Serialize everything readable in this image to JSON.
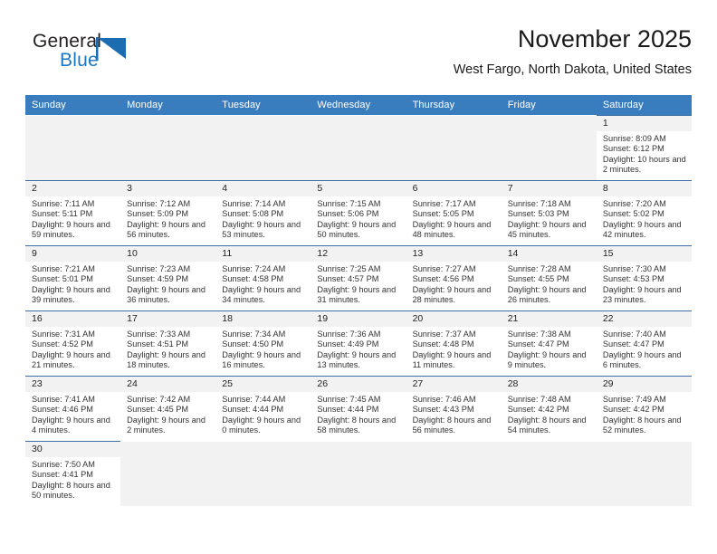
{
  "logo": {
    "text_top": "General",
    "text_bottom": "Blue",
    "triangle_icon": "blue-triangle-icon",
    "color": "#1b77c4"
  },
  "header": {
    "title": "November 2025",
    "subtitle": "West Fargo, North Dakota, United States"
  },
  "theme": {
    "header_row_bg": "#3a7dbf",
    "cell_header_bg": "#f2f2f2",
    "cell_border": "#3a6ea5"
  },
  "weekdays": [
    "Sunday",
    "Monday",
    "Tuesday",
    "Wednesday",
    "Thursday",
    "Friday",
    "Saturday"
  ],
  "labels": {
    "sunrise": "Sunrise:",
    "sunset": "Sunset:",
    "daylight": "Daylight:"
  },
  "weeks": [
    [
      {
        "blank": true
      },
      {
        "blank": true
      },
      {
        "blank": true
      },
      {
        "blank": true
      },
      {
        "blank": true
      },
      {
        "blank": true
      },
      {
        "day": "1",
        "sunrise": "Sunrise: 8:09 AM",
        "sunset": "Sunset: 6:12 PM",
        "daylight": "Daylight: 10 hours and 2 minutes."
      }
    ],
    [
      {
        "day": "2",
        "sunrise": "Sunrise: 7:11 AM",
        "sunset": "Sunset: 5:11 PM",
        "daylight": "Daylight: 9 hours and 59 minutes."
      },
      {
        "day": "3",
        "sunrise": "Sunrise: 7:12 AM",
        "sunset": "Sunset: 5:09 PM",
        "daylight": "Daylight: 9 hours and 56 minutes."
      },
      {
        "day": "4",
        "sunrise": "Sunrise: 7:14 AM",
        "sunset": "Sunset: 5:08 PM",
        "daylight": "Daylight: 9 hours and 53 minutes."
      },
      {
        "day": "5",
        "sunrise": "Sunrise: 7:15 AM",
        "sunset": "Sunset: 5:06 PM",
        "daylight": "Daylight: 9 hours and 50 minutes."
      },
      {
        "day": "6",
        "sunrise": "Sunrise: 7:17 AM",
        "sunset": "Sunset: 5:05 PM",
        "daylight": "Daylight: 9 hours and 48 minutes."
      },
      {
        "day": "7",
        "sunrise": "Sunrise: 7:18 AM",
        "sunset": "Sunset: 5:03 PM",
        "daylight": "Daylight: 9 hours and 45 minutes."
      },
      {
        "day": "8",
        "sunrise": "Sunrise: 7:20 AM",
        "sunset": "Sunset: 5:02 PM",
        "daylight": "Daylight: 9 hours and 42 minutes."
      }
    ],
    [
      {
        "day": "9",
        "sunrise": "Sunrise: 7:21 AM",
        "sunset": "Sunset: 5:01 PM",
        "daylight": "Daylight: 9 hours and 39 minutes."
      },
      {
        "day": "10",
        "sunrise": "Sunrise: 7:23 AM",
        "sunset": "Sunset: 4:59 PM",
        "daylight": "Daylight: 9 hours and 36 minutes."
      },
      {
        "day": "11",
        "sunrise": "Sunrise: 7:24 AM",
        "sunset": "Sunset: 4:58 PM",
        "daylight": "Daylight: 9 hours and 34 minutes."
      },
      {
        "day": "12",
        "sunrise": "Sunrise: 7:25 AM",
        "sunset": "Sunset: 4:57 PM",
        "daylight": "Daylight: 9 hours and 31 minutes."
      },
      {
        "day": "13",
        "sunrise": "Sunrise: 7:27 AM",
        "sunset": "Sunset: 4:56 PM",
        "daylight": "Daylight: 9 hours and 28 minutes."
      },
      {
        "day": "14",
        "sunrise": "Sunrise: 7:28 AM",
        "sunset": "Sunset: 4:55 PM",
        "daylight": "Daylight: 9 hours and 26 minutes."
      },
      {
        "day": "15",
        "sunrise": "Sunrise: 7:30 AM",
        "sunset": "Sunset: 4:53 PM",
        "daylight": "Daylight: 9 hours and 23 minutes."
      }
    ],
    [
      {
        "day": "16",
        "sunrise": "Sunrise: 7:31 AM",
        "sunset": "Sunset: 4:52 PM",
        "daylight": "Daylight: 9 hours and 21 minutes."
      },
      {
        "day": "17",
        "sunrise": "Sunrise: 7:33 AM",
        "sunset": "Sunset: 4:51 PM",
        "daylight": "Daylight: 9 hours and 18 minutes."
      },
      {
        "day": "18",
        "sunrise": "Sunrise: 7:34 AM",
        "sunset": "Sunset: 4:50 PM",
        "daylight": "Daylight: 9 hours and 16 minutes."
      },
      {
        "day": "19",
        "sunrise": "Sunrise: 7:36 AM",
        "sunset": "Sunset: 4:49 PM",
        "daylight": "Daylight: 9 hours and 13 minutes."
      },
      {
        "day": "20",
        "sunrise": "Sunrise: 7:37 AM",
        "sunset": "Sunset: 4:48 PM",
        "daylight": "Daylight: 9 hours and 11 minutes."
      },
      {
        "day": "21",
        "sunrise": "Sunrise: 7:38 AM",
        "sunset": "Sunset: 4:47 PM",
        "daylight": "Daylight: 9 hours and 9 minutes."
      },
      {
        "day": "22",
        "sunrise": "Sunrise: 7:40 AM",
        "sunset": "Sunset: 4:47 PM",
        "daylight": "Daylight: 9 hours and 6 minutes."
      }
    ],
    [
      {
        "day": "23",
        "sunrise": "Sunrise: 7:41 AM",
        "sunset": "Sunset: 4:46 PM",
        "daylight": "Daylight: 9 hours and 4 minutes."
      },
      {
        "day": "24",
        "sunrise": "Sunrise: 7:42 AM",
        "sunset": "Sunset: 4:45 PM",
        "daylight": "Daylight: 9 hours and 2 minutes."
      },
      {
        "day": "25",
        "sunrise": "Sunrise: 7:44 AM",
        "sunset": "Sunset: 4:44 PM",
        "daylight": "Daylight: 9 hours and 0 minutes."
      },
      {
        "day": "26",
        "sunrise": "Sunrise: 7:45 AM",
        "sunset": "Sunset: 4:44 PM",
        "daylight": "Daylight: 8 hours and 58 minutes."
      },
      {
        "day": "27",
        "sunrise": "Sunrise: 7:46 AM",
        "sunset": "Sunset: 4:43 PM",
        "daylight": "Daylight: 8 hours and 56 minutes."
      },
      {
        "day": "28",
        "sunrise": "Sunrise: 7:48 AM",
        "sunset": "Sunset: 4:42 PM",
        "daylight": "Daylight: 8 hours and 54 minutes."
      },
      {
        "day": "29",
        "sunrise": "Sunrise: 7:49 AM",
        "sunset": "Sunset: 4:42 PM",
        "daylight": "Daylight: 8 hours and 52 minutes."
      }
    ],
    [
      {
        "day": "30",
        "sunrise": "Sunrise: 7:50 AM",
        "sunset": "Sunset: 4:41 PM",
        "daylight": "Daylight: 8 hours and 50 minutes."
      },
      {
        "blank": true
      },
      {
        "blank": true
      },
      {
        "blank": true
      },
      {
        "blank": true
      },
      {
        "blank": true
      },
      {
        "blank": true
      }
    ]
  ]
}
